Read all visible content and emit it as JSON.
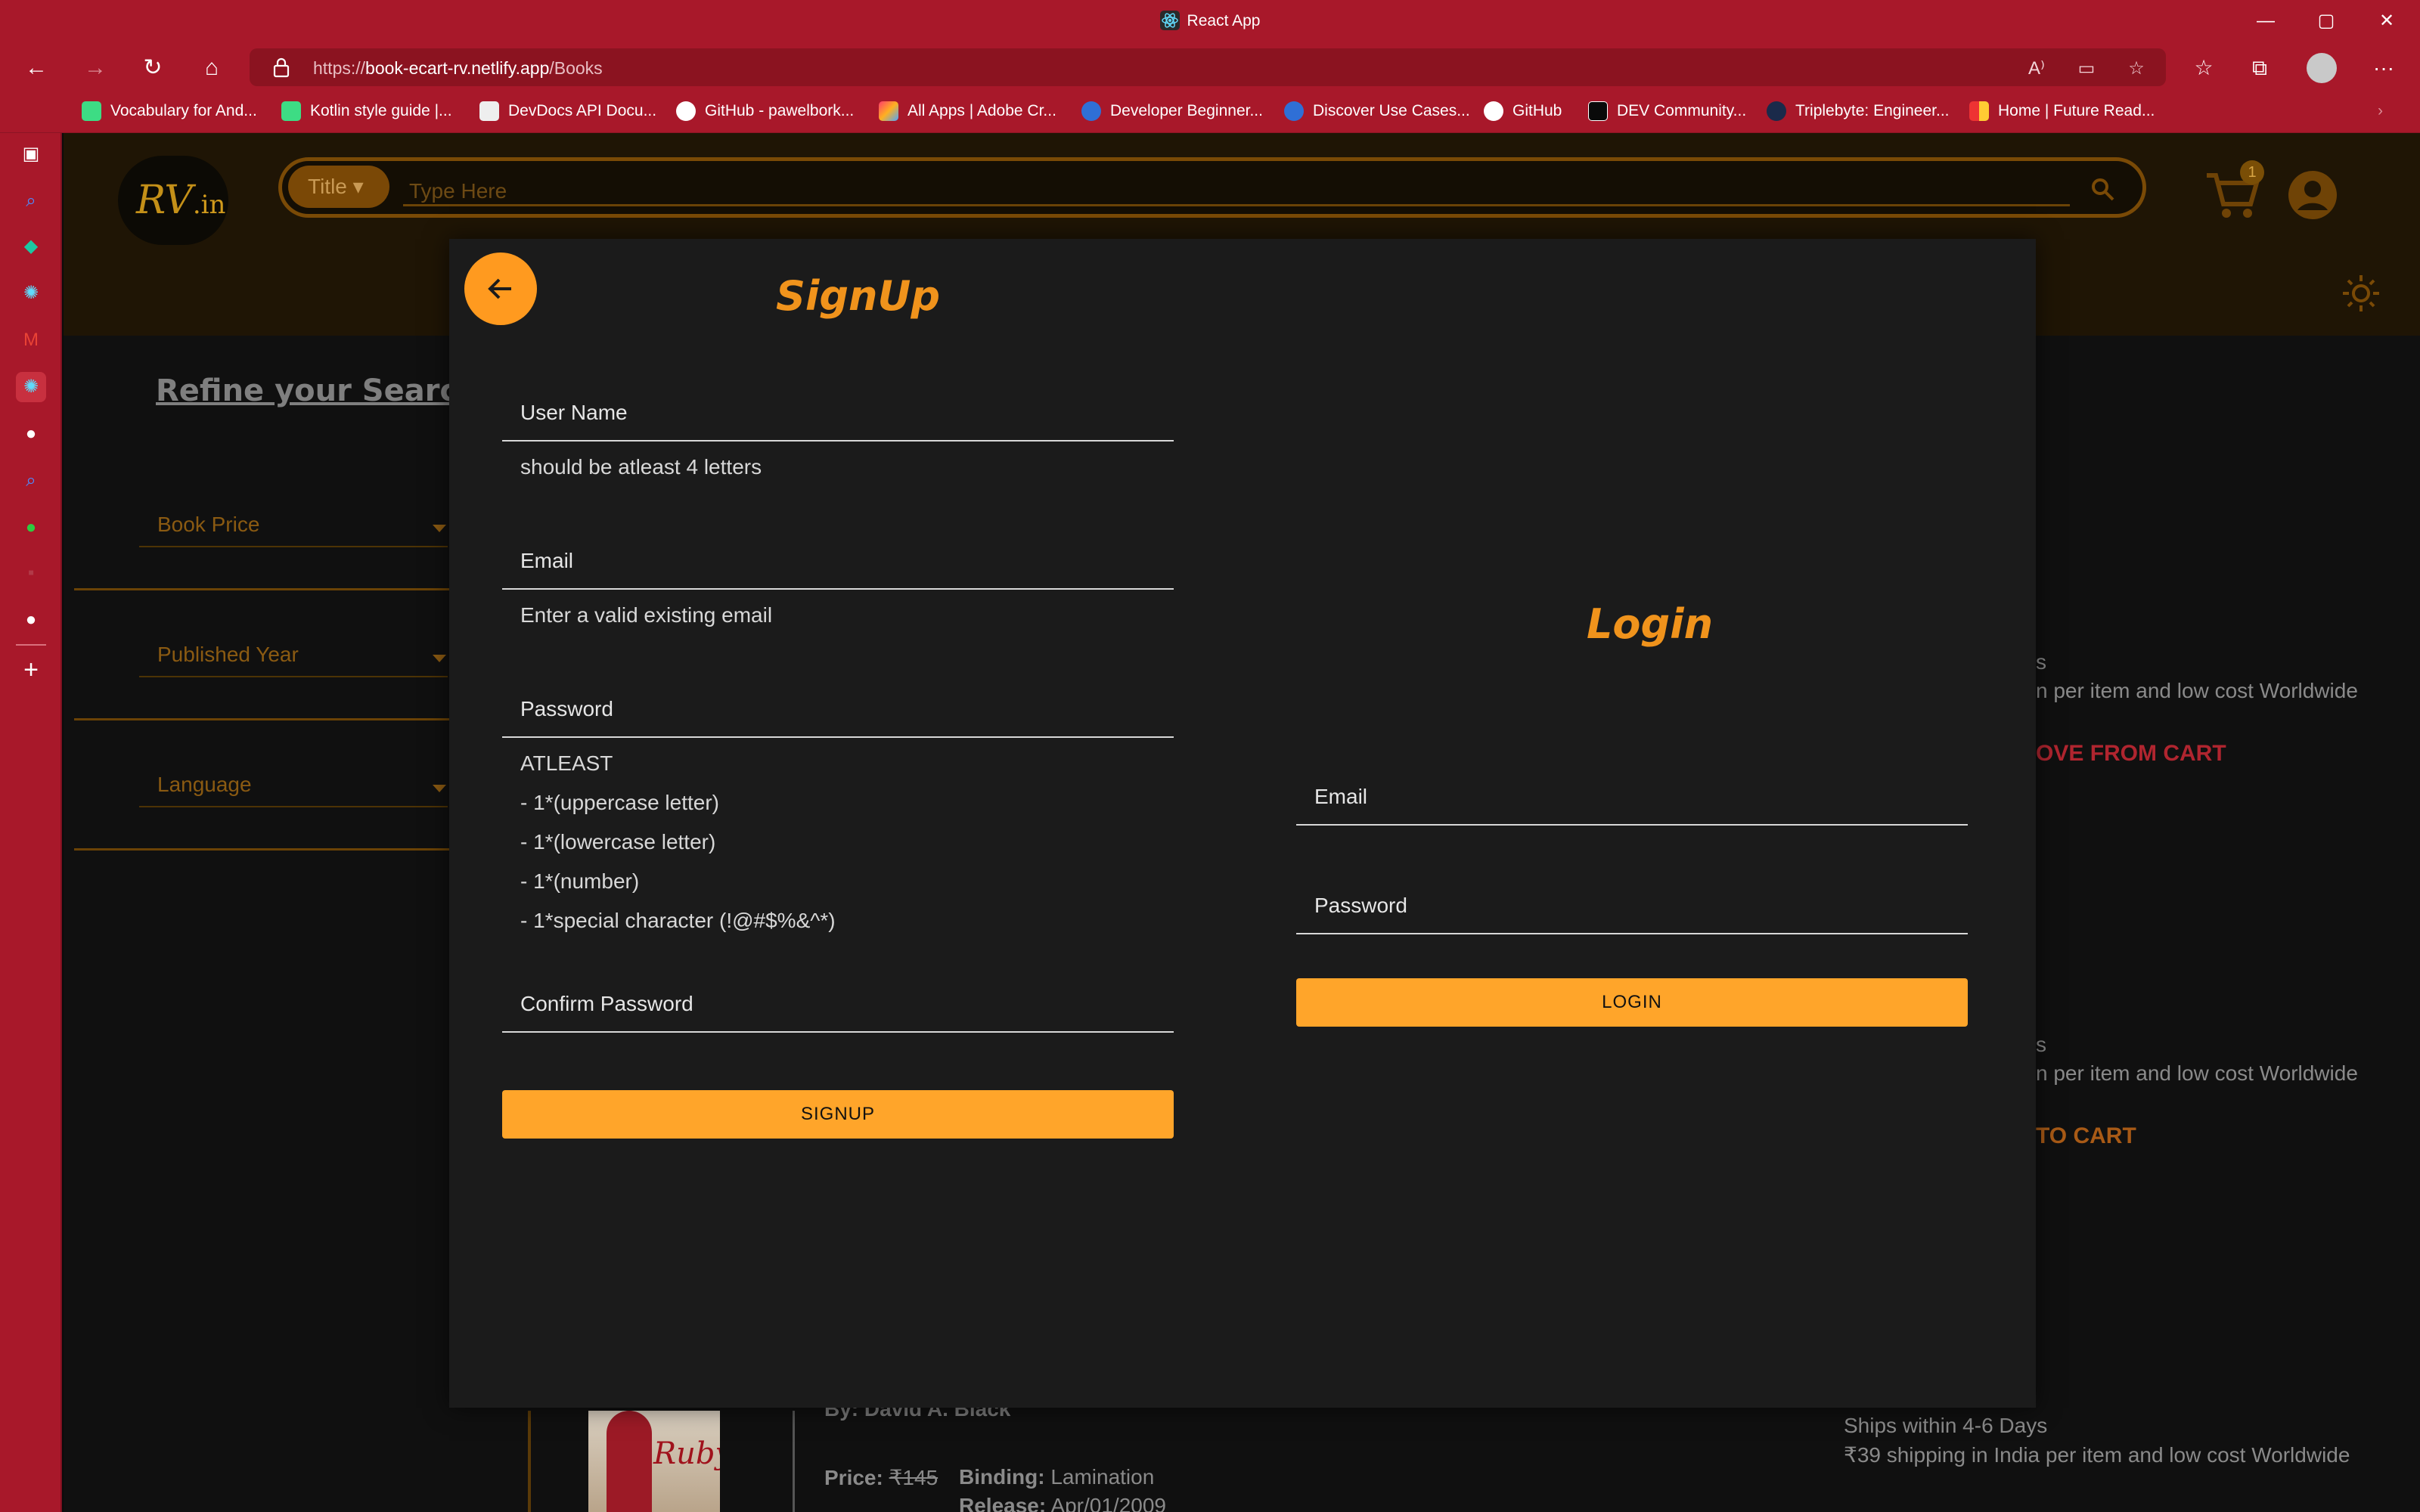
{
  "browser": {
    "window_title": "React App",
    "url_scheme": "https://",
    "url_host": "book-ecart-rv.netlify.app",
    "url_path": "/Books",
    "bookmarks": [
      "Vocabulary for And...",
      "Kotlin style guide |...",
      "DevDocs API Docu...",
      "GitHub - pawelbork...",
      "All Apps | Adobe Cr...",
      "Developer Beginner...",
      "Discover Use Cases...",
      "GitHub",
      "DEV Community...",
      "Triplebyte: Engineer...",
      "Home | Future Read..."
    ]
  },
  "header": {
    "logo_text": "RV",
    "logo_suffix": ".in",
    "search_select": "Title",
    "search_placeholder": "Type Here",
    "cart_count": "1"
  },
  "filters": {
    "heading": "Refine your Search",
    "items": [
      "Book Price",
      "Published Year",
      "Language"
    ]
  },
  "background_books": {
    "shipping_fragment_1": "n per item and low cost Worldwide",
    "remove_fragment": "OVE FROM CART",
    "shipping_fragment_2": "n per item and low cost Worldwide",
    "add_fragment": "TO CART",
    "s_fragment_1": "s",
    "s_fragment_2": "s",
    "book_title_short": "Rubyist",
    "author": "By: David A. Black",
    "price_label": "Price:",
    "price_value": "₹145",
    "binding_label": "Binding:",
    "binding_value": "Lamination",
    "release_label": "Release:",
    "release_value": "Apr/01/2009",
    "ships": "Ships within 4-6 Days",
    "shipping_full": "₹39 shipping in India per item and low cost Worldwide"
  },
  "signup": {
    "title": "SignUp",
    "username_label": "User Name",
    "username_helper": "should be atleast 4 letters",
    "email_label": "Email",
    "email_helper": "Enter a valid existing email",
    "password_label": "Password",
    "password_rules": [
      "ATLEAST",
      "- 1*(uppercase letter)",
      "- 1*(lowercase letter)",
      "- 1*(number)",
      "- 1*special character (!@#$%&^*)"
    ],
    "confirm_label": "Confirm Password",
    "button": "SIGNUP"
  },
  "login": {
    "title": "Login",
    "email_label": "Email",
    "password_label": "Password",
    "button": "LOGIN"
  },
  "colors": {
    "browser_chrome": "#a8182a",
    "accent": "#ffa52a",
    "heading": "#f0931c",
    "modal_bg": "#1b1b1b"
  }
}
